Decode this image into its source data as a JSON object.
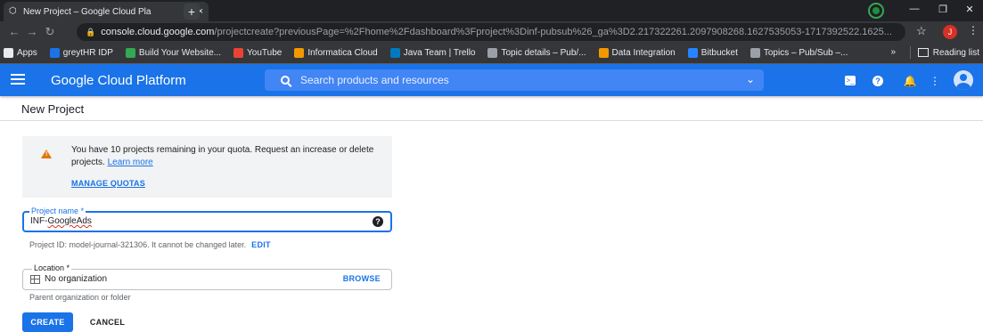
{
  "browser": {
    "tab_title": "New Project – Google Cloud Pla",
    "tab_close": "×",
    "new_tab": "+",
    "url_host": "console.cloud.google.com",
    "url_path": "/projectcreate?previousPage=%2Fhome%2Fdashboard%3Fproject%3Dinf-pubsub%26_ga%3D2.217322261.2097908268.1627535053-1717392522.1625...",
    "profile_initial": "J",
    "bookmarks": [
      {
        "label": "Apps",
        "color": "#e8eaed"
      },
      {
        "label": "greytHR IDP",
        "color": "#1a73e8"
      },
      {
        "label": "Build Your Website...",
        "color": "#34a853"
      },
      {
        "label": "YouTube",
        "color": "#ea4335"
      },
      {
        "label": "Informatica Cloud",
        "color": "#f29900"
      },
      {
        "label": "Java Team | Trello",
        "color": "#0079bf"
      },
      {
        "label": "Topic details – Pub/...",
        "color": "#9aa0a6"
      },
      {
        "label": "Data Integration",
        "color": "#f29900"
      },
      {
        "label": "Bitbucket",
        "color": "#2684ff"
      },
      {
        "label": "Topics – Pub/Sub –...",
        "color": "#9aa0a6"
      }
    ],
    "more_bookmarks": "»",
    "reading_list": "Reading list"
  },
  "gcp": {
    "product_title": "Google Cloud Platform",
    "search_placeholder": "Search products and resources",
    "accent": "#1a73e8"
  },
  "page": {
    "title": "New Project",
    "quota_message": "You have 10 projects remaining in your quota. Request an increase or delete projects.",
    "learn_more": "Learn more",
    "manage_quotas": "MANAGE QUOTAS",
    "project_name_label": "Project name *",
    "project_name_value_prefix": "INF-",
    "project_name_value_suffix": "GoogleAds",
    "project_id_text": "Project ID: model-journal-321306. It cannot be changed later.",
    "edit_label": "EDIT",
    "location_label": "Location *",
    "location_value": "No organization",
    "browse_label": "BROWSE",
    "location_helper": "Parent organization or folder",
    "create_label": "CREATE",
    "cancel_label": "CANCEL"
  }
}
